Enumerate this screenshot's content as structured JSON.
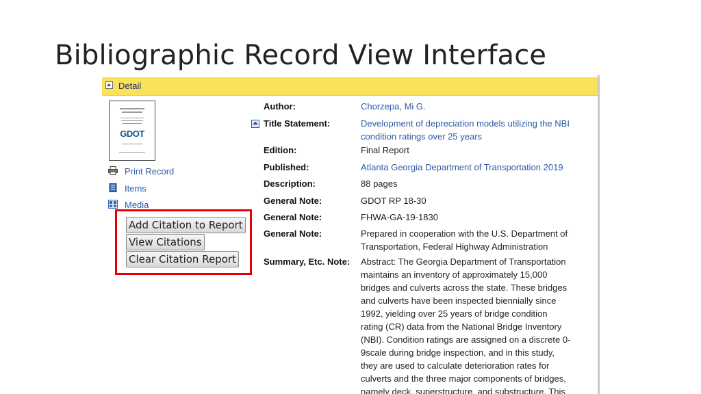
{
  "slide_title": "Bibliographic Record View Interface",
  "detail_bar": {
    "label": "Detail"
  },
  "thumbnail": {
    "logo_text": "GDOT"
  },
  "side_links": [
    {
      "label": "Print Record",
      "icon": "printer-icon"
    },
    {
      "label": "Items",
      "icon": "items-icon"
    },
    {
      "label": "Media",
      "icon": "media-icon"
    }
  ],
  "citation_buttons": [
    {
      "label": "Add Citation to Report"
    },
    {
      "label": "View Citations"
    },
    {
      "label": "Clear Citation Report"
    }
  ],
  "record": {
    "author": {
      "label": "Author:",
      "value": "Chorzepa, Mi G."
    },
    "title": {
      "label": "Title Statement:",
      "value_line1": "Development of depreciation models utilizing the NBI",
      "value_line2": "condition ratings over 25 years"
    },
    "edition": {
      "label": "Edition:",
      "value": "Final Report"
    },
    "published": {
      "label": "Published:",
      "value": "Atlanta Georgia Department of Transportation 2019"
    },
    "description": {
      "label": "Description:",
      "value": "88 pages"
    },
    "note1": {
      "label": "General Note:",
      "value": "GDOT RP 18-30"
    },
    "note2": {
      "label": "General Note:",
      "value": "FHWA-GA-19-1830"
    },
    "note3": {
      "label": "General Note:",
      "value_line1": "Prepared in cooperation with the U.S. Department of",
      "value_line2": "Transportation, Federal Highway Administration"
    },
    "summary": {
      "label": "Summary, Etc. Note:",
      "lines": [
        "Abstract: The Georgia Department of Transportation",
        "maintains an inventory of approximately 15,000",
        "bridges and culverts across the state. These bridges",
        "and culverts have been inspected biennially since",
        "1992, yielding over 25 years of bridge condition",
        "rating (CR) data from the National Bridge Inventory",
        "(NBI). Condition ratings are assigned on a discrete 0-",
        "9scale during bridge inspection, and in this study,",
        "they are used to calculate deterioration rates for",
        "culverts and the three major components of bridges,",
        "namely deck, superstructure, and substructure. This"
      ]
    }
  }
}
